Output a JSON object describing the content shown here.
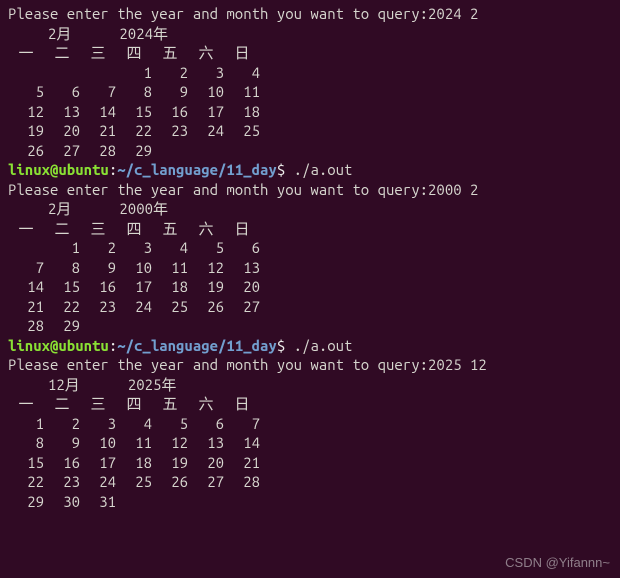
{
  "prompts": {
    "label": "Please enter the year and month you want to query:",
    "inputs": [
      "2024 2",
      "2000 2",
      "2025 12"
    ]
  },
  "shell": {
    "userhost": "linux@ubuntu",
    "colon": ":",
    "path": "~/c_language/11_day",
    "dollar": "$ ",
    "cmd": "./a.out"
  },
  "weekdays": [
    "一",
    "二",
    "三",
    "四",
    "五",
    "六",
    "日"
  ],
  "cal1": {
    "month_label": "2月",
    "year_label": "2024年",
    "rows": [
      [
        "",
        "",
        "",
        "1",
        "2",
        "3",
        "4"
      ],
      [
        "5",
        "6",
        "7",
        "8",
        "9",
        "10",
        "11"
      ],
      [
        "12",
        "13",
        "14",
        "15",
        "16",
        "17",
        "18"
      ],
      [
        "19",
        "20",
        "21",
        "22",
        "23",
        "24",
        "25"
      ],
      [
        "26",
        "27",
        "28",
        "29",
        "",
        "",
        ""
      ]
    ]
  },
  "cal2": {
    "month_label": "2月",
    "year_label": "2000年",
    "rows": [
      [
        "",
        "1",
        "2",
        "3",
        "4",
        "5",
        "6"
      ],
      [
        "7",
        "8",
        "9",
        "10",
        "11",
        "12",
        "13"
      ],
      [
        "14",
        "15",
        "16",
        "17",
        "18",
        "19",
        "20"
      ],
      [
        "21",
        "22",
        "23",
        "24",
        "25",
        "26",
        "27"
      ],
      [
        "28",
        "29",
        "",
        "",
        "",
        "",
        ""
      ]
    ]
  },
  "cal3": {
    "month_label": "12月",
    "year_label": "2025年",
    "rows": [
      [
        "1",
        "2",
        "3",
        "4",
        "5",
        "6",
        "7"
      ],
      [
        "8",
        "9",
        "10",
        "11",
        "12",
        "13",
        "14"
      ],
      [
        "15",
        "16",
        "17",
        "18",
        "19",
        "20",
        "21"
      ],
      [
        "22",
        "23",
        "24",
        "25",
        "26",
        "27",
        "28"
      ],
      [
        "29",
        "30",
        "31",
        "",
        "",
        "",
        ""
      ]
    ]
  },
  "watermark": "CSDN @Yifannn~"
}
